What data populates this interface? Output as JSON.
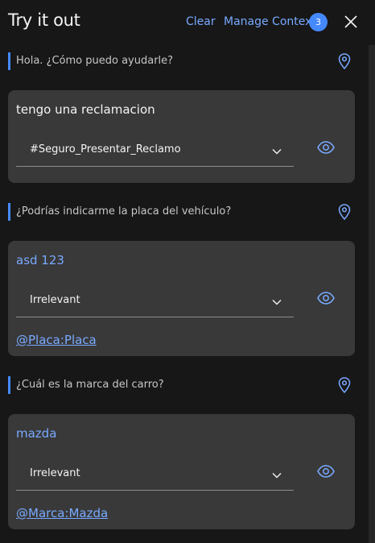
{
  "header": {
    "title": "Try it out",
    "clear_label": "Clear",
    "manage_context_label": "Manage Context",
    "context_count": "3"
  },
  "conversation": [
    {
      "bot_message": "Hola. ¿Cómo puedo ayudarle?",
      "user_message": "tengo una reclamacion",
      "intent_selected": "#Seguro_Presentar_Reclamo",
      "entity": ""
    },
    {
      "bot_message": "¿Podrías indicarme la placa del vehículo?",
      "user_message": "asd 123",
      "intent_selected": "Irrelevant",
      "entity": "@Placa:Placa"
    },
    {
      "bot_message": "¿Cuál es la marca del carro?",
      "user_message": "mazda",
      "intent_selected": "Irrelevant",
      "entity": "@Marca:Mazda"
    }
  ],
  "colors": {
    "background": "#171717",
    "card": "#393939",
    "accent": "#78a9ff",
    "badge": "#4589ff"
  },
  "icons": {
    "close": "close-icon",
    "location": "location-pin-icon",
    "eye": "eye-icon",
    "chevron": "chevron-down-icon"
  }
}
